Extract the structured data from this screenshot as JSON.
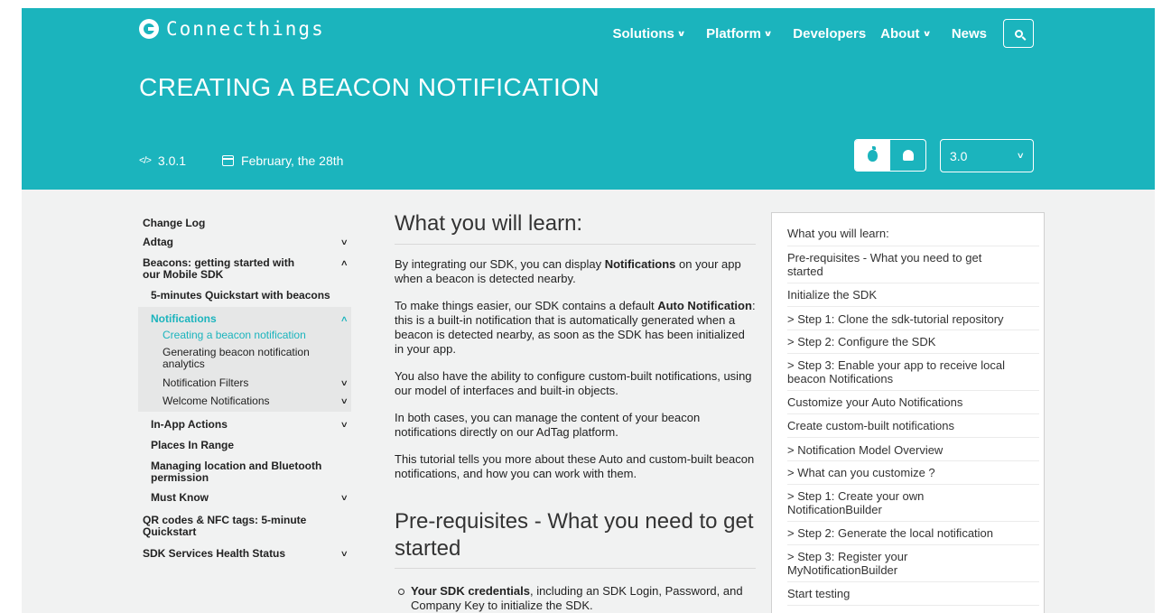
{
  "brand": {
    "name": "Connecthings"
  },
  "nav": {
    "items": [
      {
        "label": "Solutions",
        "chevron": true
      },
      {
        "label": "Platform",
        "chevron": true
      },
      {
        "label": "Developers",
        "chevron": false
      },
      {
        "label": "About",
        "chevron": true
      },
      {
        "label": "News",
        "chevron": false
      }
    ]
  },
  "hero": {
    "title": "CREATING A BEACON NOTIFICATION",
    "version_prefix": "</>",
    "version": "3.0.1",
    "date": "February, the 28th",
    "selected_version": "3.0"
  },
  "sidebar": {
    "items": [
      {
        "label": "Change Log",
        "chevron": ""
      },
      {
        "label": "Adtag",
        "chevron": "v"
      },
      {
        "label": "Beacons: getting started with our Mobile SDK",
        "chevron": "^"
      },
      {
        "label": "5-minutes Quickstart with beacons",
        "chevron": ""
      },
      {
        "label": "Notifications",
        "chevron": "^"
      },
      {
        "label": "Creating a beacon notification",
        "chevron": ""
      },
      {
        "label": "Generating beacon notification analytics",
        "chevron": ""
      },
      {
        "label": "Notification Filters",
        "chevron": "v"
      },
      {
        "label": "Welcome Notifications",
        "chevron": "v"
      },
      {
        "label": "In-App Actions",
        "chevron": "v"
      },
      {
        "label": "Places In Range",
        "chevron": ""
      },
      {
        "label": "Managing location and Bluetooth permission",
        "chevron": ""
      },
      {
        "label": "Must Know",
        "chevron": "v"
      },
      {
        "label": "QR codes & NFC tags: 5-minute Quickstart",
        "chevron": ""
      },
      {
        "label": "SDK Services Health Status",
        "chevron": "v"
      }
    ]
  },
  "content": {
    "heading1": "What you will learn:",
    "p1_a": "By integrating our SDK, you can display ",
    "p1_b": "Notifications",
    "p1_c": " on your app when a beacon is detected nearby.",
    "p2_a": "To make things easier, our SDK contains a default ",
    "p2_b": "Auto Notification",
    "p2_c": ": this is a built-in notification that is automatically generated when a beacon is detected nearby, as soon as the SDK has been initialized in your app.",
    "p3": "You also have the ability to configure custom-built notifications, using our model of interfaces and built-in objects.",
    "p4": "In both cases, you can manage the content of your beacon notifications directly on our AdTag platform.",
    "p5": "This tutorial tells you more about these Auto and custom-built beacon notifications, and how you can work with them.",
    "heading2": "Pre-requisites - What you need to get started",
    "bullet1_a": "Your SDK credentials",
    "bullet1_b": ", including an SDK Login, Password, and Company Key to initialize the SDK."
  },
  "toc": {
    "items": [
      "What you will learn:",
      "Pre-requisites - What you need to get started",
      "Initialize the SDK",
      "> Step 1: Clone the sdk-tutorial repository",
      "> Step 2: Configure the SDK",
      "> Step 3: Enable your app to receive local beacon Notifications",
      "Customize your Auto Notifications",
      "Create custom-built notifications",
      "> Notification Model Overview",
      "> What can you customize ?",
      "> Step 1: Create your own NotificationBuilder",
      "> Step 2: Generate the local notification",
      "> Step 3: Register your MyNotificationBuilder",
      "Start testing"
    ]
  },
  "colors": {
    "accent": "#1bb4bd",
    "page_bg": "#f1f2f2"
  }
}
